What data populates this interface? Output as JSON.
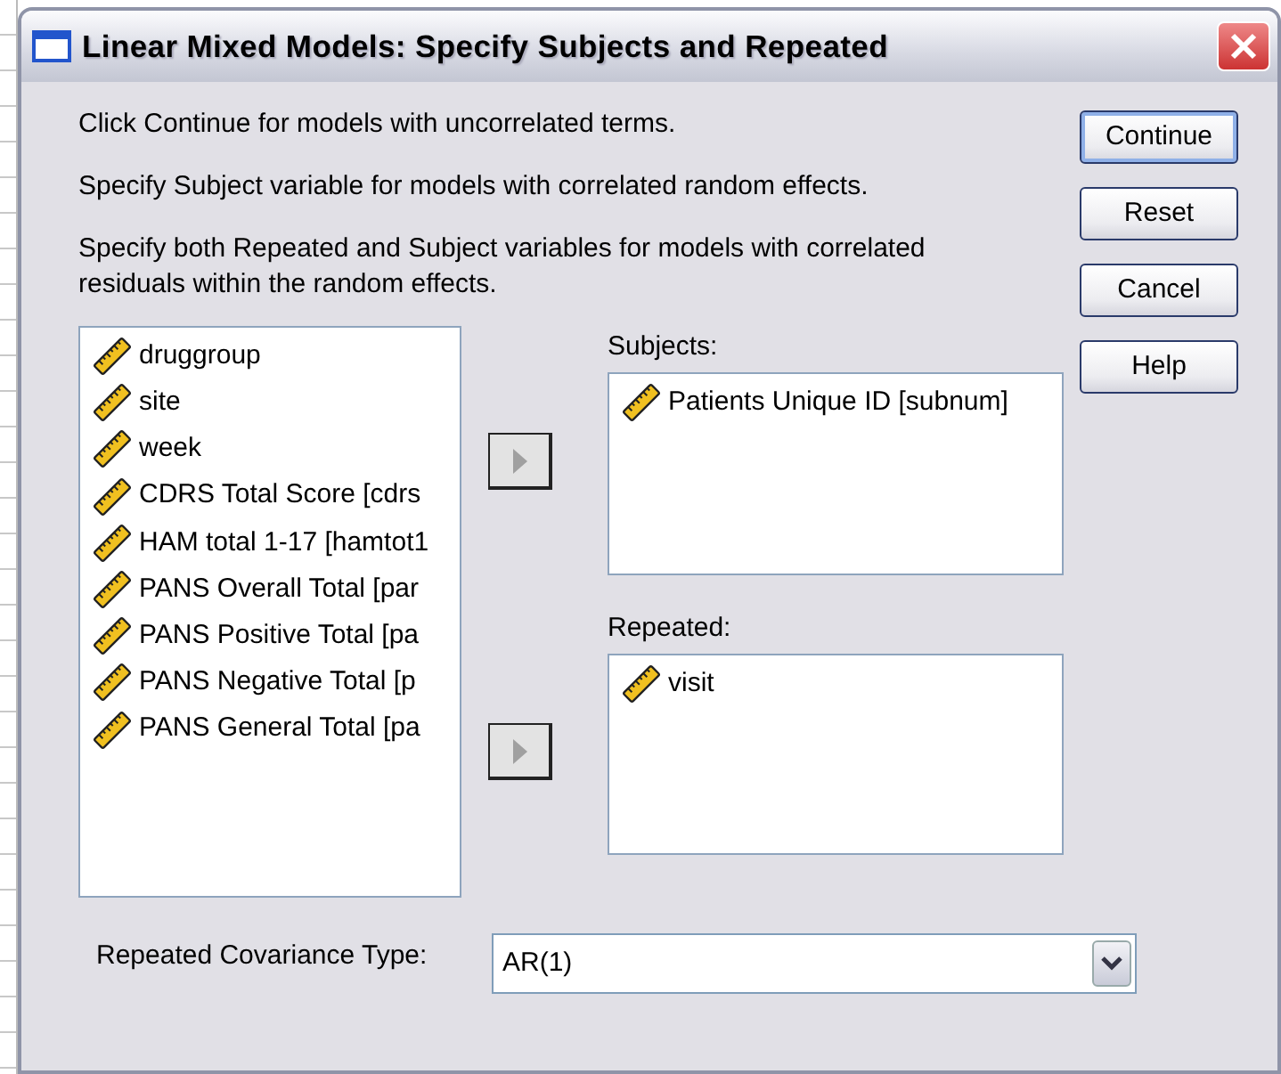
{
  "window": {
    "title": "Linear Mixed Models: Specify Subjects and Repeated"
  },
  "instructions": [
    "Click Continue for models with uncorrelated terms.",
    "Specify Subject variable for models with correlated random effects.",
    "Specify both Repeated and Subject variables for models with correlated residuals within the random effects."
  ],
  "variables": [
    {
      "name": "druggroup",
      "kind": "scale"
    },
    {
      "name": "site",
      "kind": "scale"
    },
    {
      "name": "week",
      "kind": "scale"
    },
    {
      "name": "CDRS Total Score [cdrs",
      "kind": "scale"
    },
    {
      "name": "HAM total 1-17 [hamtot1",
      "kind": "scale"
    },
    {
      "name": "PANS Overall Total [par",
      "kind": "scale"
    },
    {
      "name": "PANS Positive Total [pa",
      "kind": "scale"
    },
    {
      "name": "PANS Negative Total [p",
      "kind": "scale"
    },
    {
      "name": "PANS General Total [pa",
      "kind": "scale"
    }
  ],
  "subjects": {
    "label": "Subjects:",
    "move_button": {
      "disabled": true
    },
    "items": [
      {
        "name": "Patients Unique ID [subnum]",
        "kind": "scale"
      }
    ]
  },
  "repeated": {
    "label": "Repeated:",
    "move_button": {
      "disabled": true
    },
    "items": [
      {
        "name": "visit",
        "kind": "scale"
      }
    ]
  },
  "covariance_type": {
    "label": "Repeated Covariance Type:",
    "value": "AR(1)"
  },
  "buttons": [
    {
      "label": "Continue",
      "default": true
    },
    {
      "label": "Reset",
      "default": false
    },
    {
      "label": "Cancel",
      "default": false
    },
    {
      "label": "Help",
      "default": false
    }
  ]
}
